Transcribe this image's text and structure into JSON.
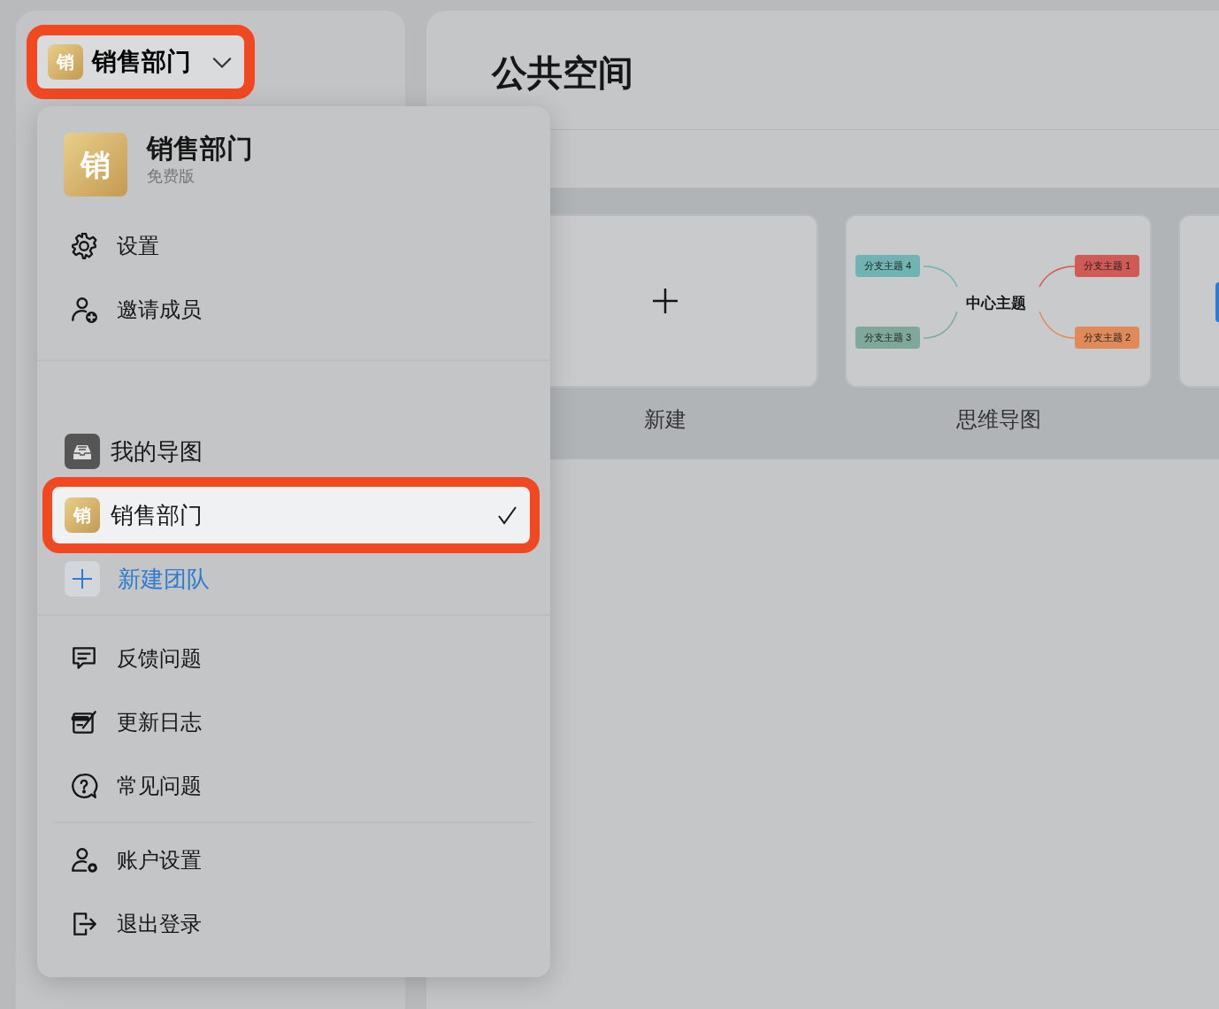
{
  "team_switcher": {
    "logo_char": "销",
    "name": "销售部门",
    "highlighted": true
  },
  "main": {
    "title": "公共空间",
    "templates": [
      {
        "kind": "new",
        "label": "新建"
      },
      {
        "kind": "mindmap",
        "label": "思维导图",
        "map": {
          "center": "中心主题",
          "branches": [
            {
              "text": "分支主题 4",
              "color": "#6fb3b3"
            },
            {
              "text": "分支主题 1",
              "color": "#d05a55"
            },
            {
              "text": "分支主题 3",
              "color": "#7fa89a"
            },
            {
              "text": "分支主题 2",
              "color": "#e08a5a"
            }
          ]
        }
      },
      {
        "kind": "partial"
      }
    ]
  },
  "menu": {
    "team": {
      "logo_char": "销",
      "name": "销售部门",
      "plan": "免费版"
    },
    "team_actions": [
      {
        "label": "设置"
      },
      {
        "label": "邀请成员"
      }
    ],
    "workspaces": [
      {
        "kind": "personal",
        "label": "我的导图",
        "selected": false,
        "highlighted": false
      },
      {
        "kind": "team",
        "logo_char": "销",
        "label": "销售部门",
        "selected": true,
        "highlighted": true
      },
      {
        "kind": "create",
        "label": "新建团队",
        "selected": false,
        "highlighted": false
      }
    ],
    "help_items": [
      {
        "label": "反馈问题"
      },
      {
        "label": "更新日志"
      },
      {
        "label": "常见问题"
      }
    ],
    "account_items": [
      {
        "label": "账户设置"
      },
      {
        "label": "退出登录"
      }
    ]
  }
}
